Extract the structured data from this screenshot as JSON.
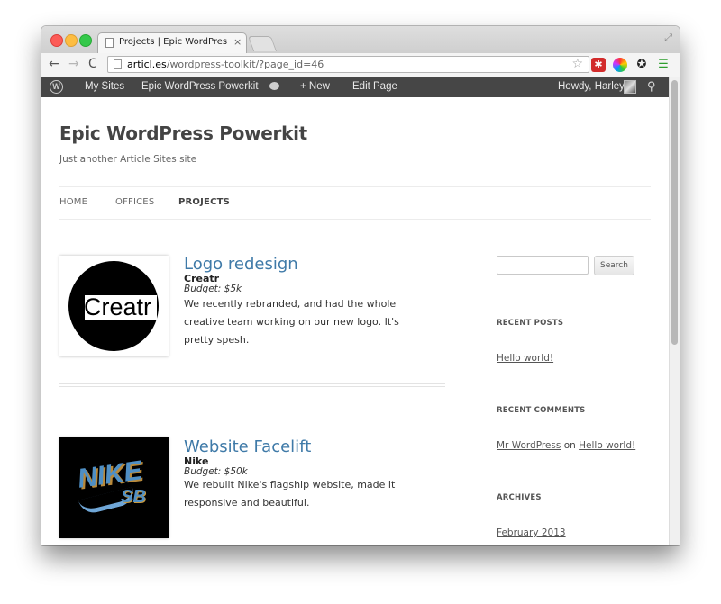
{
  "browser": {
    "tab_title": "Projects | Epic WordPress Powerkit",
    "tab_close": "×",
    "url_host": "articl.es",
    "url_path": "/wordpress-toolkit/?page_id=46",
    "back_icon": "←",
    "forward_icon": "→",
    "reload_icon": "C",
    "star_icon": "☆",
    "resize_icon": "⤢"
  },
  "adminbar": {
    "my_sites": "My Sites",
    "site_name": "Epic WordPress Powerkit",
    "new_label": "+ New",
    "edit_page": "Edit Page",
    "howdy": "Howdy, Harley",
    "wp_logo": "W",
    "search_icon": "⚲"
  },
  "site": {
    "title": "Epic WordPress Powerkit",
    "tagline": "Just another Article Sites site",
    "nav": [
      "HOME",
      "OFFICES",
      "PROJECTS"
    ],
    "active_nav": "PROJECTS"
  },
  "projects": [
    {
      "title": "Logo redesign",
      "client": "Creatr",
      "budget": "Budget: $5k",
      "excerpt": "We recently rebranded, and had the whole creative team working on our new logo. It's pretty spesh.",
      "thumb_text": "Creatr"
    },
    {
      "title": "Website Facelift",
      "client": "Nike",
      "budget": "Budget: $50k",
      "excerpt": "We rebuilt Nike's flagship website, made it responsive and beautiful.",
      "thumb_text": "NIKE",
      "thumb_sub": "SB"
    }
  ],
  "sidebar": {
    "search_button": "Search",
    "recent_posts_title": "RECENT POSTS",
    "recent_post": "Hello world!",
    "recent_comments_title": "RECENT COMMENTS",
    "comment_author": "Mr WordPress",
    "comment_on": "on",
    "comment_post": "Hello world!",
    "archives_title": "ARCHIVES",
    "archive_month": "February 2013"
  },
  "colors": {
    "adminbar_bg": "#464646",
    "link_blue": "#3f7aa8",
    "close_red": "#fc5b57",
    "minimize_yellow": "#fdbd41",
    "maximize_green": "#34c84a"
  }
}
